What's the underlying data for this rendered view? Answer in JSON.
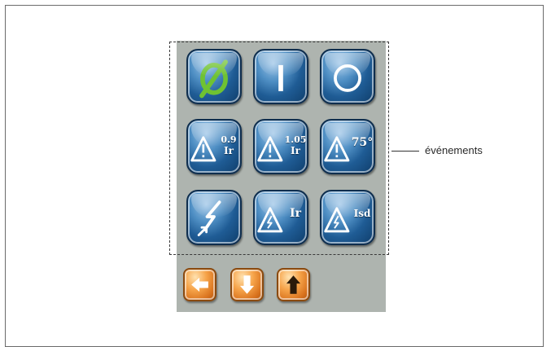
{
  "event_buttons": {
    "row1": [
      {
        "icon": "empty-set-icon"
      },
      {
        "icon": "power-on-icon"
      },
      {
        "icon": "power-off-icon"
      }
    ],
    "row2": [
      {
        "icon": "warning-icon",
        "text_top": "0.9",
        "text_bottom": "Ir"
      },
      {
        "icon": "warning-icon",
        "text_top": "1.05",
        "text_bottom": "Ir"
      },
      {
        "icon": "warning-icon",
        "text": "75°"
      }
    ],
    "row3": [
      {
        "icon": "lightning-fault-icon"
      },
      {
        "icon": "warning-lightning-icon",
        "text": "Ir"
      },
      {
        "icon": "warning-lightning-icon",
        "text": "Isd"
      }
    ]
  },
  "navigation": [
    {
      "icon": "arrow-left-icon"
    },
    {
      "icon": "arrow-down-icon"
    },
    {
      "icon": "arrow-up-icon"
    }
  ],
  "annotation": {
    "label": "événements"
  },
  "colors": {
    "button_blue": "#1f5c95",
    "nav_orange": "#f6a44a",
    "panel_gray": "#aeb4af",
    "glyph_green": "#6fc232"
  }
}
